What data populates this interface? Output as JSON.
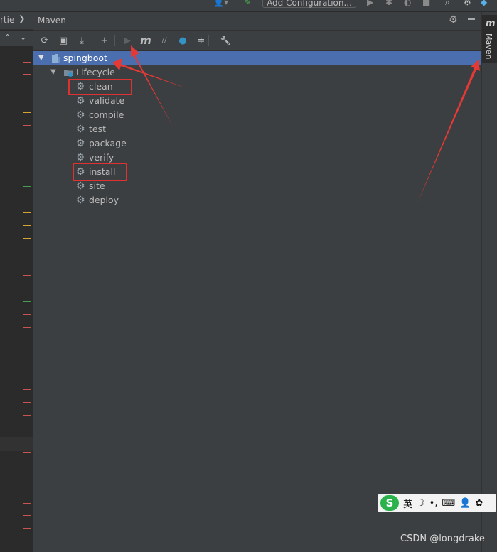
{
  "topbar": {
    "add_config_label": "Add Configuration..."
  },
  "leftstrip": {
    "tab_fragment": "rtie",
    "chevron": "❯"
  },
  "panel": {
    "title": "Maven",
    "toolbar": [
      {
        "name": "reload-icon",
        "glyph": "⟳"
      },
      {
        "name": "add-folder-icon",
        "glyph": "▣"
      },
      {
        "name": "download-icon",
        "glyph": "⤓"
      },
      {
        "name": "add-icon",
        "glyph": "+"
      },
      {
        "name": "run-icon",
        "glyph": "▶"
      },
      {
        "name": "maven-goal-icon",
        "glyph": "m"
      },
      {
        "name": "skip-tests-icon",
        "glyph": "⧸⧸"
      },
      {
        "name": "offline-icon",
        "glyph": "●"
      },
      {
        "name": "collapse-icon",
        "glyph": "≑"
      },
      {
        "name": "settings-wrench-icon",
        "glyph": "🔧"
      }
    ],
    "tree": {
      "project": "spingboot",
      "lifecycle": "Lifecycle",
      "goals": [
        "clean",
        "validate",
        "compile",
        "test",
        "package",
        "verify",
        "install",
        "site",
        "deploy"
      ]
    }
  },
  "rightstrip": {
    "tab_glyph": "m",
    "tab_label": "Maven"
  },
  "ime": {
    "s_glyph": "S",
    "chars": [
      "英",
      "☽",
      "•,",
      "⌨",
      "👤",
      "✿"
    ]
  },
  "watermark": "CSDN @longdrake",
  "colors": {
    "selection": "#4b6eaf",
    "annotation_red": "#e03131",
    "panel_bg": "#3c3f41"
  }
}
